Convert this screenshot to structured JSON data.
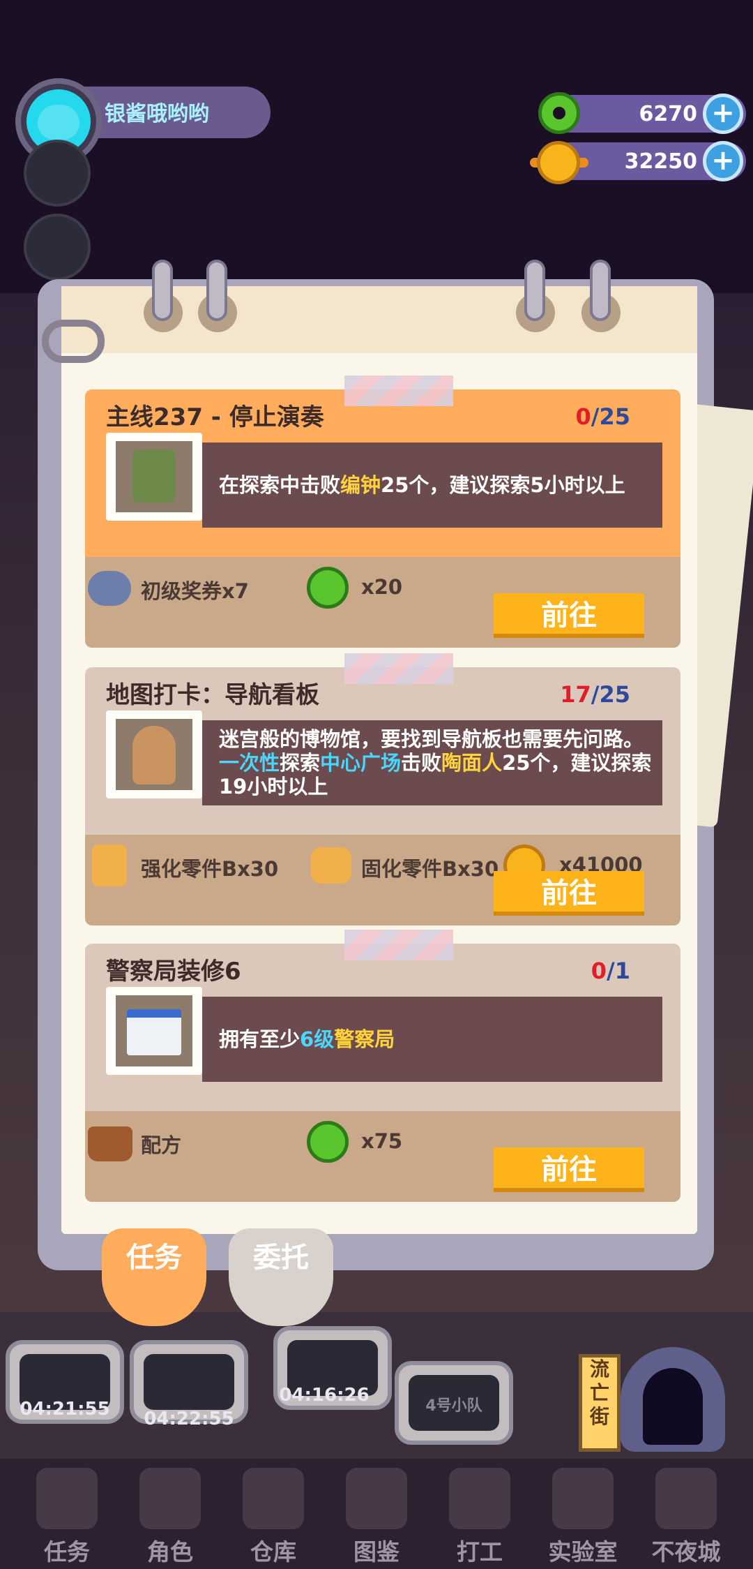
{
  "player": {
    "name": "银酱哦哟哟"
  },
  "currency": {
    "donut": "6270",
    "coin": "32250",
    "plus": "+"
  },
  "tasks": [
    {
      "title": "主线237 - 停止演奏",
      "progress_done": "0",
      "progress_total": "/25",
      "desc_parts": [
        "在探索中击败",
        "编钟",
        "25个，建议探索5小时以上"
      ],
      "rewards": [
        {
          "label": "初级奖券x7",
          "icon": "ticket-icon"
        },
        {
          "label": "x20",
          "icon": "donut-icon"
        }
      ],
      "button": "前往",
      "header_color": "#ffad5c"
    },
    {
      "title": "地图打卡：导航看板",
      "progress_done": "17",
      "progress_total": "/25",
      "desc_parts": [
        "迷宫般的博物馆，要找到导航板也需要先问路。",
        "一次性",
        "探索",
        "中心广场",
        "击败",
        "陶面人",
        "25个，建议探索",
        "19小时以上"
      ],
      "rewards": [
        {
          "label": "强化零件Bx30",
          "icon": "bolt-icon"
        },
        {
          "label": "固化零件Bx30",
          "icon": "nut-icon"
        },
        {
          "label": "x41000",
          "icon": "coin-icon"
        }
      ],
      "button": "前往",
      "header_color": "#dcc7bb"
    },
    {
      "title": "警察局装修6",
      "progress_done": "0",
      "progress_total": "/1",
      "desc_parts": [
        "拥有至少",
        "6级",
        "警察局"
      ],
      "rewards": [
        {
          "label": "配方",
          "icon": "basket-icon"
        },
        {
          "label": "x75",
          "icon": "donut-icon"
        }
      ],
      "button": "前往",
      "header_color": "#dcc7bb"
    }
  ],
  "tabs": {
    "missions": "任务",
    "commission": "委托"
  },
  "squads": [
    {
      "timer": "04:21:55"
    },
    {
      "timer": "04:22:55"
    },
    {
      "timer": "04:16:26"
    },
    {
      "label": "4号小队"
    }
  ],
  "sign": "流亡街",
  "nav": [
    "任务",
    "角色",
    "仓库",
    "图鉴",
    "打工",
    "实验室",
    "不夜城"
  ],
  "colors": {
    "accent": "#ffb31a",
    "done_red": "#e01e2a",
    "count_blue": "#2d4a9a"
  }
}
